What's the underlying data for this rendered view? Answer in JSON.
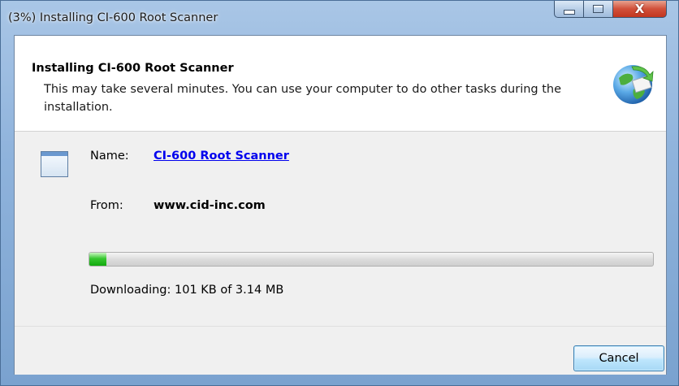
{
  "window": {
    "title": "(3%) Installing CI-600 Root Scanner",
    "controls": {
      "minimize_icon": "minimize-icon",
      "maximize_icon": "maximize-icon",
      "close_icon": "close-icon",
      "close_glyph": "X"
    }
  },
  "header": {
    "title": "Installing CI-600 Root Scanner",
    "description": "This may take several minutes. You can use your computer to do other tasks during the installation.",
    "icon": "installer-globe-icon"
  },
  "details": {
    "app_icon": "application-window-icon",
    "name_label": "Name:",
    "name_value": "CI-600 Root Scanner",
    "from_label": "From:",
    "from_value": "www.cid-inc.com"
  },
  "progress": {
    "percent": 3,
    "status_text": "Downloading: 101 KB of 3.14 MB",
    "fill_color": "#2fc22a"
  },
  "footer": {
    "cancel_label": "Cancel"
  },
  "colors": {
    "link": "#0000ee",
    "frame": "#8fb3dc",
    "panel": "#f0f0f0"
  }
}
